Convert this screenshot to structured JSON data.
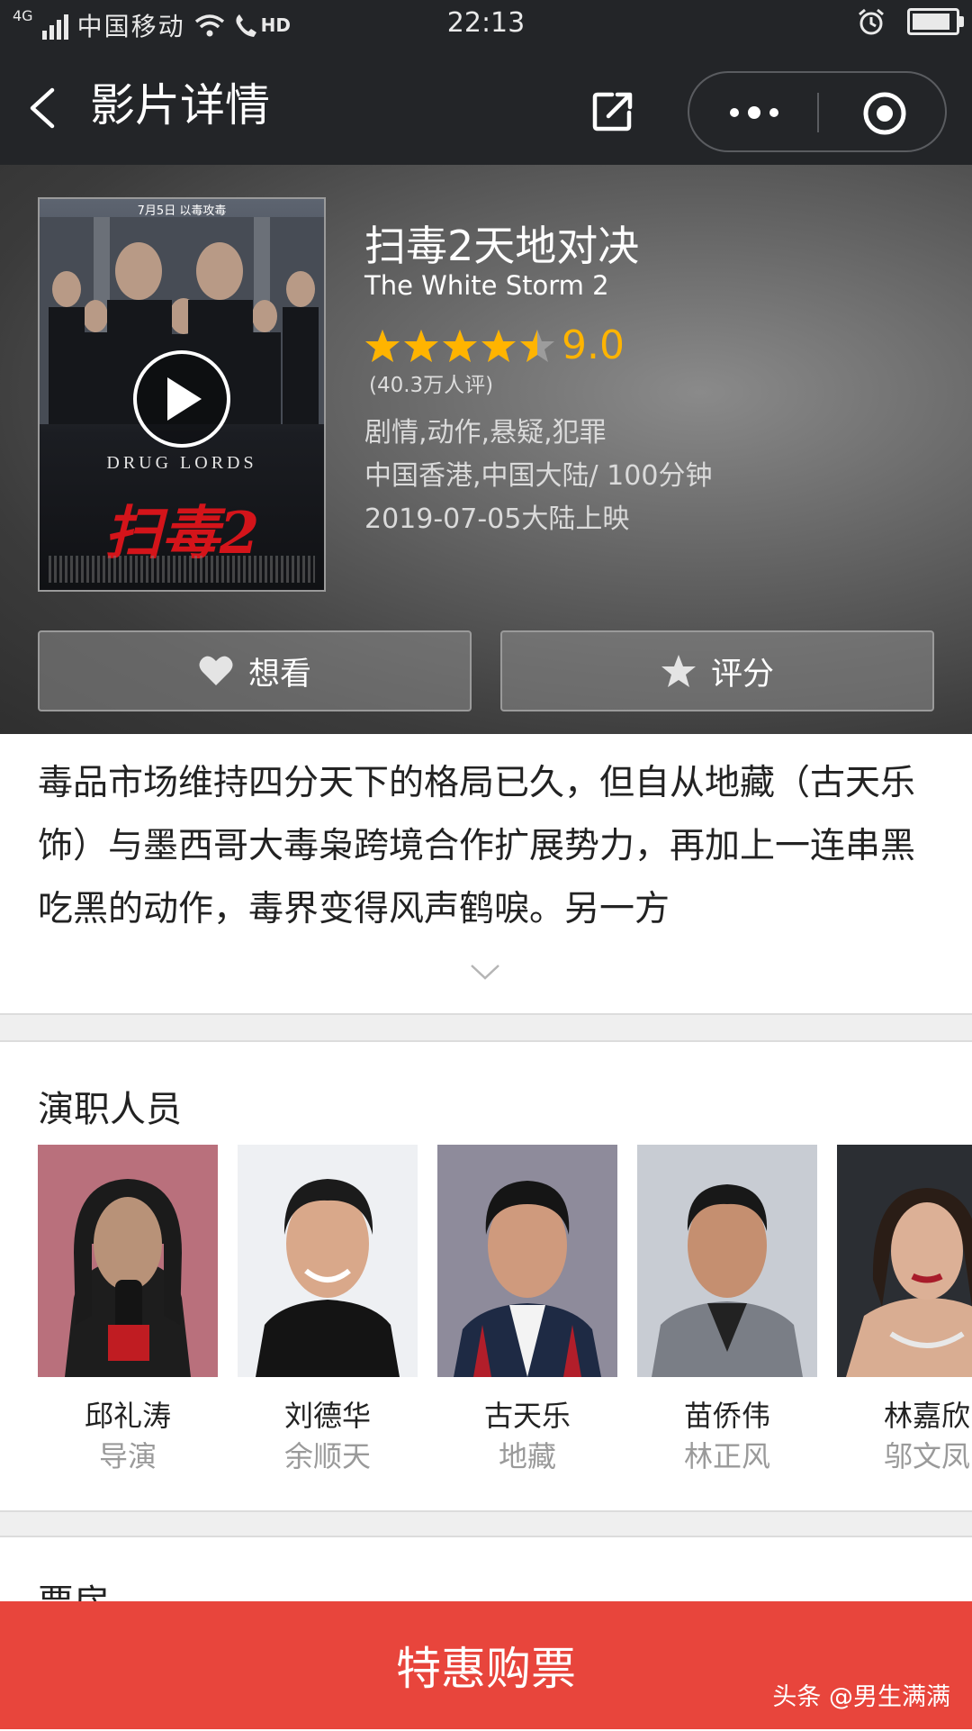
{
  "status_bar": {
    "network": "4G",
    "carrier": "中国移动",
    "hd": "HD",
    "time": "22:13",
    "battery_level": 0.9
  },
  "nav": {
    "title": "影片详情",
    "icons": [
      "back-icon",
      "share-icon",
      "more-icon",
      "target-icon"
    ]
  },
  "movie": {
    "poster": {
      "top_text": "7月5日 以毒攻毒",
      "title_en": "DRUG LORDS",
      "title_cn": "扫毒2"
    },
    "title": "扫毒2天地对决",
    "title_en": "The White Storm 2",
    "stars": 4.5,
    "score": "9.0",
    "votes": "(40.3万人评)",
    "genres": "剧情,动作,悬疑,犯罪",
    "region_duration": "中国香港,中国大陆/ 100分钟",
    "release": "2019-07-05大陆上映"
  },
  "actions": {
    "want_label": "想看",
    "rate_label": "评分"
  },
  "synopsis": {
    "text": "毒品市场维持四分天下的格局已久，但自从地藏（古天乐 饰）与墨西哥大毒枭跨境合作扩展势力，再加上一连串黑吃黑的动作，毒界变得风声鹤唳。另一方"
  },
  "cast": {
    "title": "演职人员",
    "members": [
      {
        "name": "邱礼涛",
        "role": "导演"
      },
      {
        "name": "刘德华",
        "role": "余顺天"
      },
      {
        "name": "古天乐",
        "role": "地藏"
      },
      {
        "name": "苗侨伟",
        "role": "林正风"
      },
      {
        "name": "林嘉欣",
        "role": "邬文凤"
      }
    ]
  },
  "box_office": {
    "title": "票房"
  },
  "buy": {
    "label": "特惠购票"
  },
  "watermark": "头条 @男生满满",
  "colors": {
    "accent_red": "#e8453c",
    "star_gold": "#ffb400",
    "bar_dark": "#232528"
  }
}
